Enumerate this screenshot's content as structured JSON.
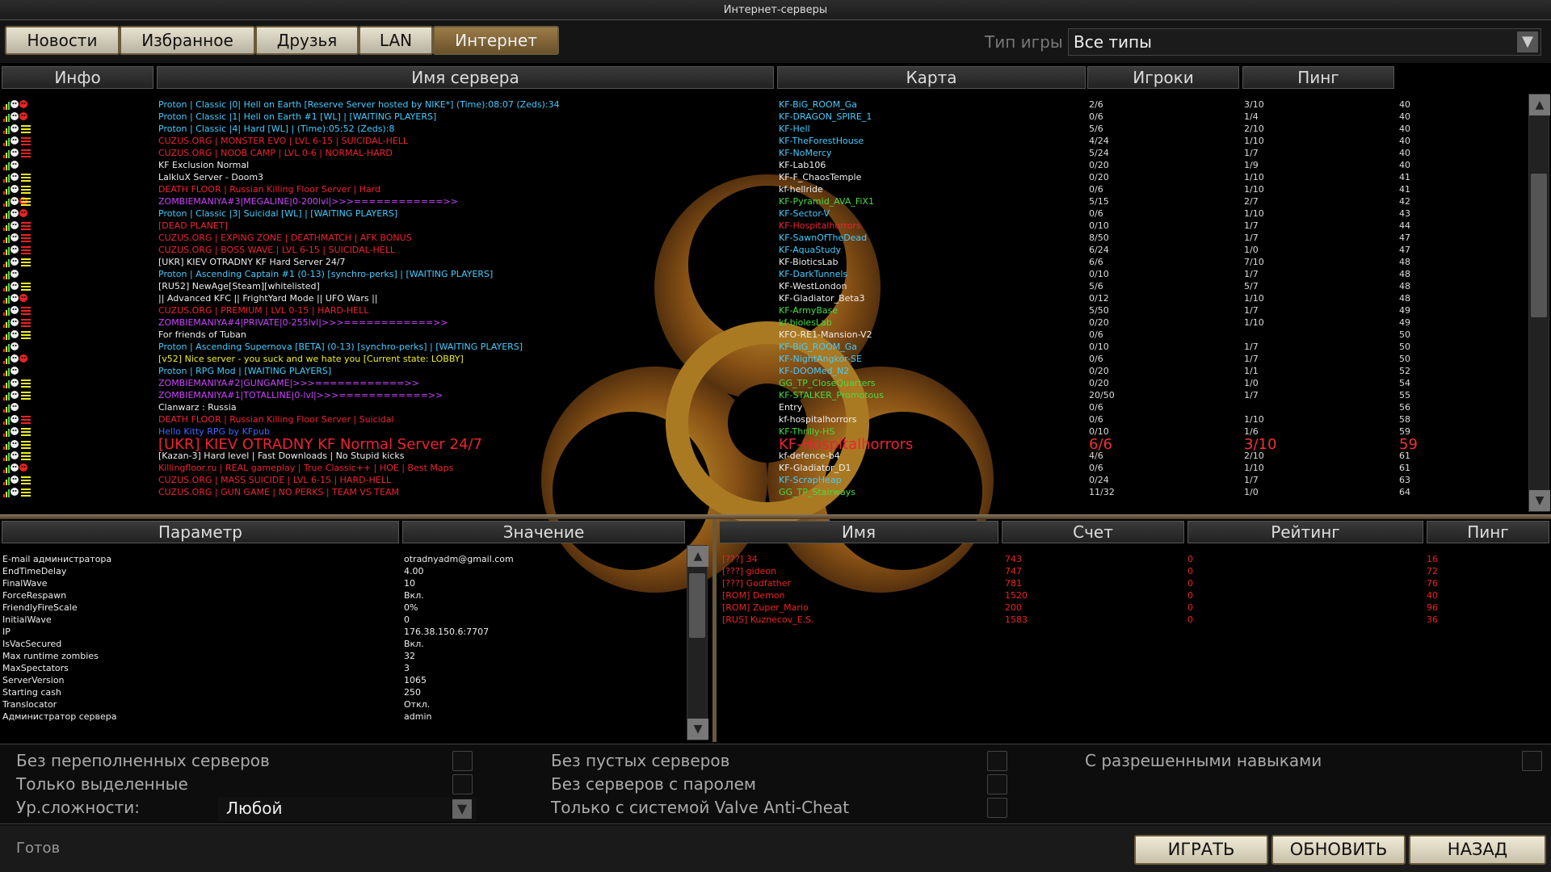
{
  "window": {
    "title": "Интернет-серверы"
  },
  "tabs": [
    {
      "label": "Новости",
      "active": false
    },
    {
      "label": "Избранное",
      "active": false
    },
    {
      "label": "Друзья",
      "active": false
    },
    {
      "label": "LAN",
      "active": false
    },
    {
      "label": "Интернет",
      "active": true
    }
  ],
  "game_type": {
    "label": "Тип игры",
    "value": "Все типы"
  },
  "server_list": {
    "headers": {
      "info": "Инфо",
      "name": "Имя сервера",
      "map": "Карта",
      "players": "Игроки",
      "ping": "Пинг"
    },
    "rows": [
      {
        "name": "Proton | Classic |0| Hell on Earth [Reserve Server hosted by NIKE*] (Time):08:07 (Zeds):34",
        "color": "cyan",
        "map": "KF-BiG_ROOM_Ga",
        "mapcolor": "cyan",
        "players": "2/6",
        "wave": "3/10",
        "ping": "40",
        "icon": "uc"
      },
      {
        "name": "Proton | Classic |1| Hell on Earth #1 [WL] | [WAITING PLAYERS]",
        "color": "cyan",
        "map": "KF-DRAGON_SPIRE_1",
        "mapcolor": "cyan",
        "players": "0/6",
        "wave": "1/4",
        "ping": "40",
        "icon": "uc"
      },
      {
        "name": "Proton | Classic |4| Hard [WL] | (Time):05:52 (Zeds):8",
        "color": "cyan",
        "map": "KF-Hell",
        "mapcolor": "cyan",
        "players": "5/6",
        "wave": "2/10",
        "ping": "40",
        "icon": "uy"
      },
      {
        "name": "CUZUS.ORG | MONSTER EVO | LVL 6-15 | SUICIDAL-HELL",
        "color": "red",
        "map": "KF-TheForestHouse",
        "mapcolor": "cyan",
        "players": "4/24",
        "wave": "1/10",
        "ping": "40",
        "icon": "dr"
      },
      {
        "name": "CUZUS.ORG | NOOB CAMP | LVL 0-6 | NORMAL-HARD",
        "color": "red",
        "map": "KF-NoMercy",
        "mapcolor": "cyan",
        "players": "5/24",
        "wave": "1/7",
        "ping": "40",
        "icon": "dr"
      },
      {
        "name": "KF Exclusion Normal",
        "color": "white",
        "map": "KF-Lab106",
        "mapcolor": "white",
        "players": "0/20",
        "wave": "1/9",
        "ping": "40",
        "icon": "d"
      },
      {
        "name": "LalkluX Server - Doom3",
        "color": "white",
        "map": "KF-F_ChaosTemple",
        "mapcolor": "white",
        "players": "0/20",
        "wave": "1/10",
        "ping": "41",
        "icon": "dy"
      },
      {
        "name": "DEATH FLOOR | Russian Killing Floor Server | Hard",
        "color": "red",
        "map": "kf-hellride",
        "mapcolor": "white",
        "players": "0/6",
        "wave": "1/10",
        "ping": "41",
        "icon": "uy"
      },
      {
        "name": "ZOMBIEMANIYA#3|MEGALINE|0-200lvl|>>>============>>",
        "color": "magenta",
        "map": "KF-Pyramid_AVA_FiX1",
        "mapcolor": "green",
        "players": "5/15",
        "wave": "2/7",
        "ping": "42",
        "icon": "ucy"
      },
      {
        "name": "Proton | Classic |3| Suicidal [WL] | [WAITING PLAYERS]",
        "color": "cyan",
        "map": "KF-Sector-V",
        "mapcolor": "cyan",
        "players": "0/6",
        "wave": "1/10",
        "ping": "43",
        "icon": "uc"
      },
      {
        "name": "[DEAD PLANET]",
        "color": "red",
        "map": "KF-Hospitalhorrors",
        "mapcolor": "red",
        "players": "0/10",
        "wave": "1/7",
        "ping": "44",
        "icon": "dr"
      },
      {
        "name": "CUZUS.ORG | EXPING ZONE | DEATHMATCH | AFK BONUS",
        "color": "red",
        "map": "KF-SawnOfTheDead",
        "mapcolor": "cyan",
        "players": "8/50",
        "wave": "1/7",
        "ping": "47",
        "icon": "dr"
      },
      {
        "name": "CUZUS.ORG | BOSS WAVE | LVL 6-15 | SUICIDAL-HELL",
        "color": "red",
        "map": "KF-AquaStudy",
        "mapcolor": "cyan",
        "players": "6/24",
        "wave": "1/0",
        "ping": "47",
        "icon": "dr"
      },
      {
        "name": "[UKR] KIEV OTRADNY KF Hard Server 24/7",
        "color": "white",
        "map": "KF-BioticsLab",
        "mapcolor": "white",
        "players": "6/6",
        "wave": "7/10",
        "ping": "48",
        "icon": "uy"
      },
      {
        "name": "Proton | Ascending Captain #1 (0-13) [synchro-perks] | [WAITING PLAYERS]",
        "color": "cyan",
        "map": "KF-DarkTunnels",
        "mapcolor": "cyan",
        "players": "0/10",
        "wave": "1/7",
        "ping": "48",
        "icon": "d"
      },
      {
        "name": "[RU52] NewAge[Steam][whitelisted]",
        "color": "white",
        "map": "KF-WestLondon",
        "mapcolor": "white",
        "players": "5/6",
        "wave": "5/7",
        "ping": "48",
        "icon": "dy"
      },
      {
        "name": "|| Advanced KFC || FrightYard Mode || UFO Wars ||",
        "color": "white",
        "map": "KF-Gladiator_Beta3",
        "mapcolor": "white",
        "players": "0/12",
        "wave": "1/10",
        "ping": "48",
        "icon": "uc"
      },
      {
        "name": "CUZUS.ORG | PREMIUM | LVL 0-15 | HARD-HELL",
        "color": "red",
        "map": "KF-ArmyBase",
        "mapcolor": "green",
        "players": "5/50",
        "wave": "1/7",
        "ping": "49",
        "icon": "dr"
      },
      {
        "name": "ZOMBIEMANIYA#4|PRIVATE|0-255lvl|>>>============>>",
        "color": "magenta",
        "map": "kf-biolesLab",
        "mapcolor": "green",
        "players": "0/20",
        "wave": "1/10",
        "ping": "49",
        "icon": "dr"
      },
      {
        "name": "For friends of Tuban",
        "color": "white",
        "map": "KFO-RE1-Mansion-V2",
        "mapcolor": "white",
        "players": "0/6",
        "wave": "",
        "ping": "50",
        "icon": "uy"
      },
      {
        "name": "Proton | Ascending Supernova [BETA] (0-13) [synchro-perks] | [WAITING PLAYERS]",
        "color": "cyan",
        "map": "KF-BiG_ROOM_Ga",
        "mapcolor": "cyan",
        "players": "0/10",
        "wave": "1/7",
        "ping": "50",
        "icon": "d"
      },
      {
        "name": "[v52] Nice server - you suck and we hate you [Current state: LOBBY]",
        "color": "yellow",
        "map": "KF-NightAngkor-SE",
        "mapcolor": "cyan",
        "players": "0/6",
        "wave": "1/7",
        "ping": "50",
        "icon": "ucc"
      },
      {
        "name": "Proton | RPG Mod | [WAITING PLAYERS]",
        "color": "cyan",
        "map": "KF-DOOMed_N2",
        "mapcolor": "cyan",
        "players": "0/20",
        "wave": "1/1",
        "ping": "52",
        "icon": "d"
      },
      {
        "name": "ZOMBIEMANIYA#2|GUNGAME|>>>============>>",
        "color": "magenta",
        "map": "GG_TP_CloseQuarters",
        "mapcolor": "green",
        "players": "0/20",
        "wave": "1/0",
        "ping": "54",
        "icon": "dy"
      },
      {
        "name": "ZOMBIEMANIYA#1|TOTALLINE|0-lvl|>>>============>>",
        "color": "magenta",
        "map": "KF-STALKER_Promotous",
        "mapcolor": "green",
        "players": "20/50",
        "wave": "1/7",
        "ping": "55",
        "icon": "uy"
      },
      {
        "name": "Clanwarz : Russia",
        "color": "white",
        "map": "Entry",
        "mapcolor": "white",
        "players": "0/6",
        "wave": "",
        "ping": "56",
        "icon": "d"
      },
      {
        "name": "DEATH FLOOR | Russian Killing Floor Server | Suicidal",
        "color": "red",
        "map": "kf-hospitalhorrors",
        "mapcolor": "white",
        "players": "0/6",
        "wave": "1/10",
        "ping": "58",
        "icon": "dr"
      },
      {
        "name": "Hello Kitty RPG by KFpub",
        "color": "blue",
        "map": "KF-Thrilly-HS",
        "mapcolor": "green",
        "players": "0/10",
        "wave": "1/6",
        "ping": "59",
        "icon": "dy"
      },
      {
        "name": "[UKR] KIEV OTRADNY KF Normal Server 24/7",
        "color": "red",
        "map": "KF-Hospitalhorrors",
        "mapcolor": "red",
        "players": "6/6",
        "wave": "3/10",
        "ping": "59",
        "icon": "uy",
        "big": true
      },
      {
        "name": "[Kazan-3] Hard level | Fast Downloads | No Stupid kicks",
        "color": "white",
        "map": "kf-defence-b4",
        "mapcolor": "white",
        "players": "4/6",
        "wave": "2/10",
        "ping": "61",
        "icon": "uy"
      },
      {
        "name": "Killingfloor.ru | REAL gameplay | True Classic++ | HOE | Best Maps",
        "color": "red",
        "map": "KF-Gladiator_D1",
        "mapcolor": "white",
        "players": "0/6",
        "wave": "1/10",
        "ping": "61",
        "icon": "uc"
      },
      {
        "name": "CUZUS.ORG | MASS SUICIDE | LVL 6-15 | HARD-HELL",
        "color": "red",
        "map": "KF-ScrapHeap",
        "mapcolor": "cyan",
        "players": "0/24",
        "wave": "1/7",
        "ping": "63",
        "icon": "dy"
      },
      {
        "name": "CUZUS.ORG | GUN GAME | NO PERKS | TEAM VS TEAM",
        "color": "red",
        "map": "GG_TP_Stairways",
        "mapcolor": "green",
        "players": "11/32",
        "wave": "1/0",
        "ping": "64",
        "icon": "dy"
      }
    ]
  },
  "params": {
    "headers": {
      "param": "Параметр",
      "value": "Значение"
    },
    "rows": [
      {
        "k": "E-mail администратора",
        "v": "otradnyadm@gmail.com"
      },
      {
        "k": "EndTimeDelay",
        "v": "4.00"
      },
      {
        "k": "FinalWave",
        "v": "10"
      },
      {
        "k": "ForceRespawn",
        "v": "Вкл."
      },
      {
        "k": "FriendlyFireScale",
        "v": "0%"
      },
      {
        "k": "InitialWave",
        "v": "0"
      },
      {
        "k": "IP",
        "v": "176.38.150.6:7707"
      },
      {
        "k": "IsVacSecured",
        "v": "Вкл."
      },
      {
        "k": "Max runtime zombies",
        "v": "32"
      },
      {
        "k": "MaxSpectators",
        "v": "3"
      },
      {
        "k": "ServerVersion",
        "v": "1065"
      },
      {
        "k": "Starting cash",
        "v": "250"
      },
      {
        "k": "Translocator",
        "v": "Откл."
      },
      {
        "k": "Администратор сервера",
        "v": "admin"
      }
    ]
  },
  "players": {
    "headers": {
      "name": "Имя",
      "score": "Счет",
      "rating": "Рейтинг",
      "ping": "Пинг"
    },
    "rows": [
      {
        "name": "[???] 34",
        "score": "743",
        "rating": "0",
        "ping": "16"
      },
      {
        "name": "[???] gideon",
        "score": "747",
        "rating": "0",
        "ping": "72"
      },
      {
        "name": "[???] Godfather",
        "score": "781",
        "rating": "0",
        "ping": "76"
      },
      {
        "name": "[ROM] Demon",
        "score": "1520",
        "rating": "0",
        "ping": "40"
      },
      {
        "name": "[ROM] Zuper_Mario",
        "score": "200",
        "rating": "0",
        "ping": "96"
      },
      {
        "name": "[RUS] Kuznecov_E.S.",
        "score": "1583",
        "rating": "0",
        "ping": "36"
      }
    ]
  },
  "filters": {
    "no_full": "Без переполненных серверов",
    "only_dedicated": "Только выделенные",
    "difficulty_label": "Ур.сложности:",
    "difficulty_value": "Любой",
    "no_empty": "Без пустых серверов",
    "no_password": "Без серверов с паролем",
    "vac_only": "Только с системой Valve Anti-Cheat",
    "allowed_skills": "С разрешенными навыками"
  },
  "bottom": {
    "status": "Готов",
    "play": "ИГРАТЬ",
    "refresh": "ОБНОВИТЬ",
    "back": "НАЗАД"
  },
  "colors": {
    "accent": "#9c7c48",
    "red": "#e23",
    "cyan": "#4cf",
    "yellow": "#ee2",
    "green": "#4d4",
    "magenta": "#c4f"
  }
}
